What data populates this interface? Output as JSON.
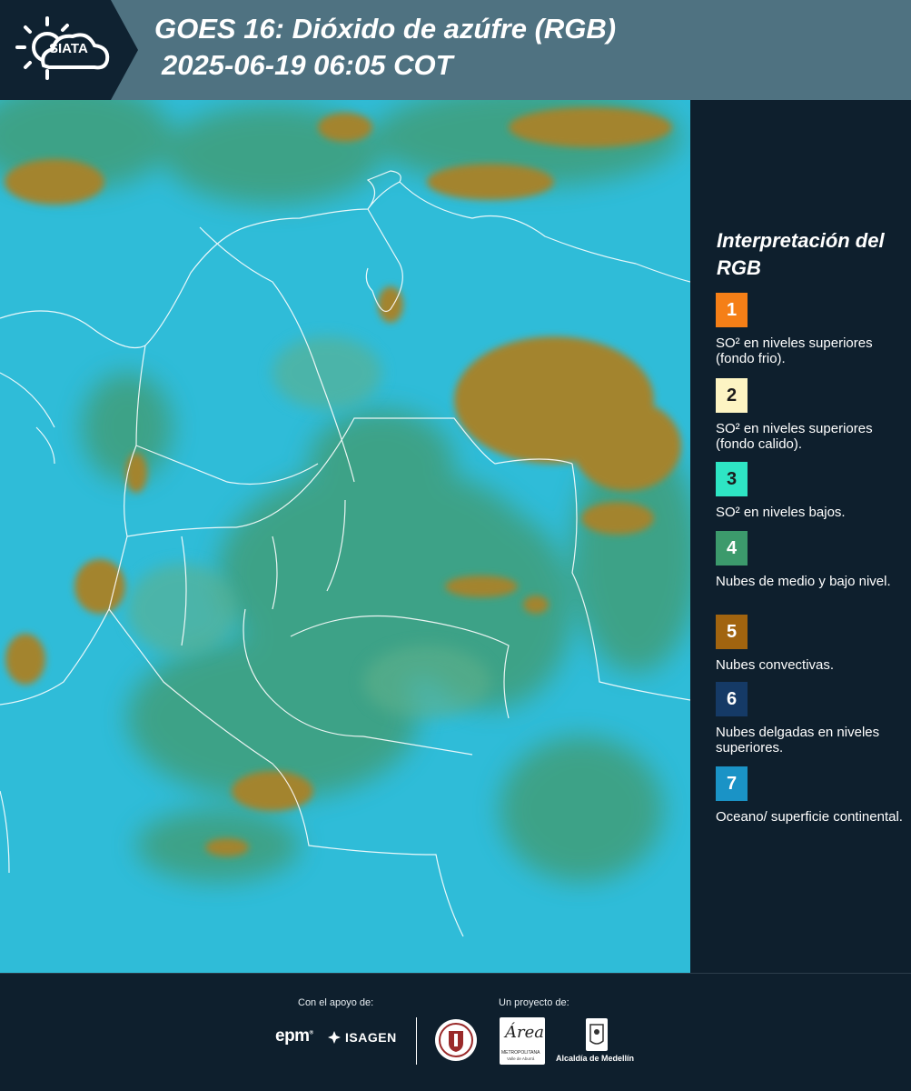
{
  "header": {
    "logo_text": "SIATA",
    "title_line1": "GOES 16: Dióxido de azúfre (RGB)",
    "title_line2": "2025-06-19 06:05 COT"
  },
  "legend": {
    "title": "Interpretación del RGB",
    "items": [
      {
        "number": "1",
        "color": "#f57f17",
        "label": "SO² en niveles superiores (fondo frio)."
      },
      {
        "number": "2",
        "color": "#fdf4c3",
        "label": "SO² en niveles superiores (fondo calido)."
      },
      {
        "number": "3",
        "color": "#2ee5c4",
        "label": "SO² en niveles bajos."
      },
      {
        "number": "4",
        "color": "#3c9a6c",
        "label": "Nubes de medio y bajo nivel."
      },
      {
        "number": "5",
        "color": "#a1640f",
        "label": "Nubes convectivas."
      },
      {
        "number": "6",
        "color": "#153a66",
        "label": "Nubes delgadas en niveles superiores."
      },
      {
        "number": "7",
        "color": "#1a93c6",
        "label": "Oceano/ superficie continental."
      }
    ]
  },
  "footer": {
    "support_label": "Con el apoyo de:",
    "project_label": "Un proyecto de:",
    "sponsor1": "epm",
    "sponsor2": "ISAGEN",
    "partner_area": "Área",
    "partner_area_sub": "METROPOLITANA",
    "partner_area_sub2": "Valle de Aburrá",
    "partner_city": "Alcaldía de Medellín"
  },
  "colors": {
    "header_bg": "#4f7281",
    "panel_bg": "#0e1f2d",
    "map_surface": "#2bb9d6",
    "cloud_mid_low": "#3f9f74",
    "cloud_convective": "#a0822a"
  }
}
